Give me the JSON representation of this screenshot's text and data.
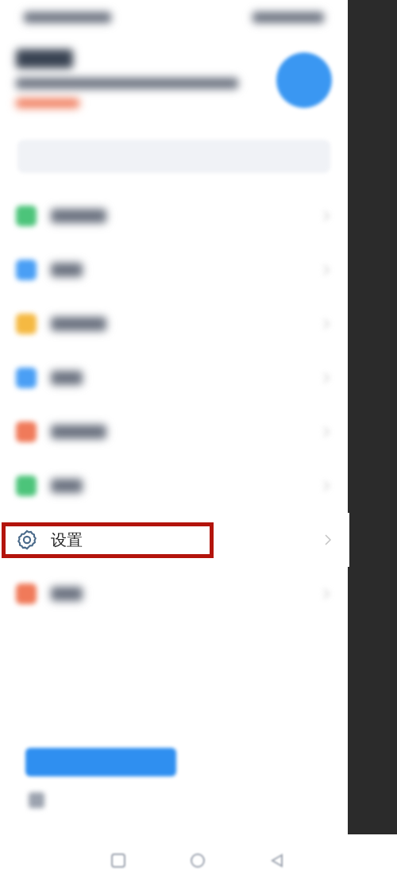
{
  "menu": [
    {
      "kind": "blurred",
      "color": "#4cc47a"
    },
    {
      "kind": "blurred",
      "color": "#4a9ff5"
    },
    {
      "kind": "blurred",
      "color": "#f5b942"
    },
    {
      "kind": "blurred",
      "color": "#4a9ff5"
    },
    {
      "kind": "blurred",
      "color": "#f07a5a"
    },
    {
      "kind": "blurred",
      "color": "#4cc47a"
    },
    {
      "kind": "clear",
      "label": "设置",
      "highlighted": true
    },
    {
      "kind": "blurred",
      "color": "#f07a5a"
    }
  ]
}
